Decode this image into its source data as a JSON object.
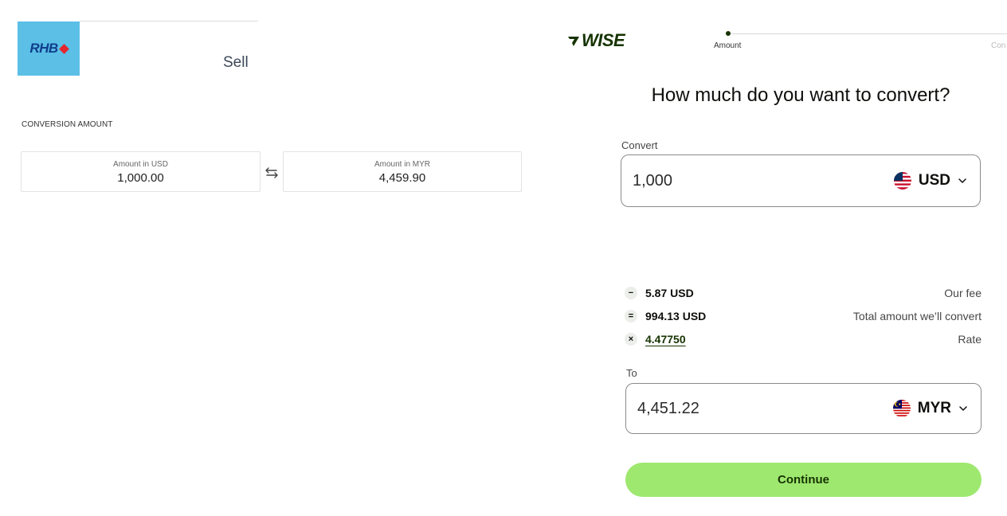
{
  "rhb": {
    "logo_text": "RHB",
    "sell_label": "Sell",
    "conversion_label": "CONVERSION AMOUNT",
    "from_box": {
      "label": "Amount in USD",
      "value": "1,000.00"
    },
    "to_box": {
      "label": "Amount in MYR",
      "value": "4,459.90"
    },
    "colors": {
      "logo_bg": "#5bbfe6",
      "logo_text": "#0f3d8c",
      "logo_diamond": "#e3262f"
    },
    "icons": {
      "swap": "swap-arrows-icon"
    }
  },
  "wise": {
    "logo_text": "WISE",
    "steps": {
      "current": "Amount",
      "next": "Con"
    },
    "title": "How much do you want to convert?",
    "convert": {
      "label": "Convert",
      "value": "1,000",
      "currency": "USD",
      "flag": "us-flag-icon"
    },
    "fees": [
      {
        "icon": "−",
        "amount": "5.87 USD",
        "description": "Our fee"
      },
      {
        "icon": "=",
        "amount": "994.13 USD",
        "description": "Total amount we’ll convert"
      },
      {
        "icon": "×",
        "amount": "4.47750",
        "description": "Rate"
      }
    ],
    "to": {
      "label": "To",
      "value": "4,451.22",
      "currency": "MYR",
      "flag": "my-flag-icon"
    },
    "continue_label": "Continue",
    "colors": {
      "brand_dark": "#163300",
      "brand_green": "#9fe870",
      "border": "#8a8c89"
    }
  }
}
